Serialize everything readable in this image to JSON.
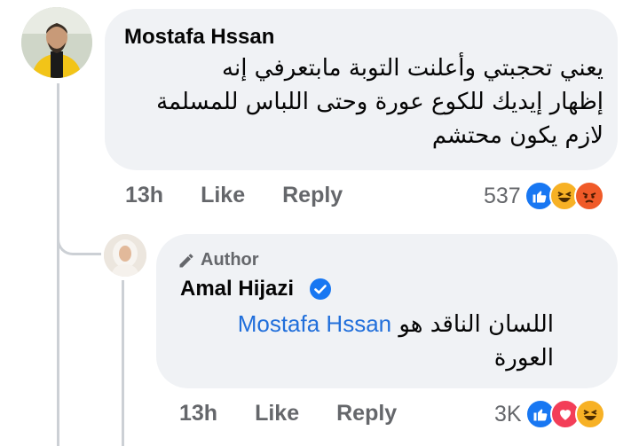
{
  "comment": {
    "author": "Mostafa Hssan",
    "text_lines": [
      "يعني تحجبتي وأعلنت التوبة مابتعرفي إنه",
      "إظهار إيديك للكوع عورة وحتى اللباس للمسلمة",
      "لازم يكون محتشم"
    ],
    "time": "13h",
    "like_label": "Like",
    "reply_label": "Reply",
    "reaction_count": "537",
    "reactions": [
      "like-icon",
      "haha-icon",
      "angry-icon"
    ]
  },
  "reply": {
    "badge": "Author",
    "author": "Amal Hijazi",
    "mention": "Mostafa Hssan",
    "text_after_mention": "اللسان الناقد هو",
    "text_line2": "العورة",
    "time": "13h",
    "like_label": "Like",
    "reply_label": "Reply",
    "reaction_count": "3K",
    "reactions": [
      "like-icon",
      "love-icon",
      "haha-icon"
    ]
  },
  "colors": {
    "bubble": "#f0f2f5",
    "mention": "#216fdb",
    "meta": "#65676b",
    "verified": "#1877f2"
  }
}
